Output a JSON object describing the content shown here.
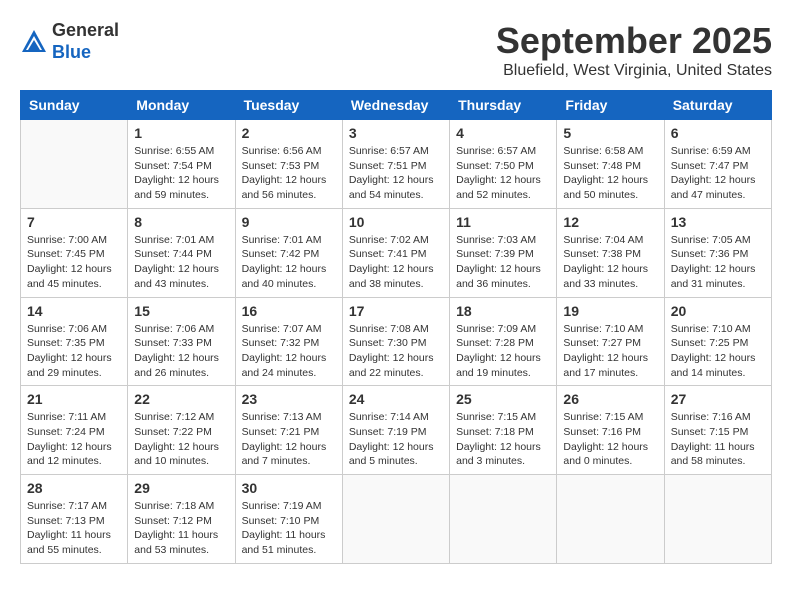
{
  "header": {
    "logo_general": "General",
    "logo_blue": "Blue",
    "month_title": "September 2025",
    "location": "Bluefield, West Virginia, United States"
  },
  "weekdays": [
    "Sunday",
    "Monday",
    "Tuesday",
    "Wednesday",
    "Thursday",
    "Friday",
    "Saturday"
  ],
  "weeks": [
    [
      {
        "day": "",
        "info": ""
      },
      {
        "day": "1",
        "info": "Sunrise: 6:55 AM\nSunset: 7:54 PM\nDaylight: 12 hours\nand 59 minutes."
      },
      {
        "day": "2",
        "info": "Sunrise: 6:56 AM\nSunset: 7:53 PM\nDaylight: 12 hours\nand 56 minutes."
      },
      {
        "day": "3",
        "info": "Sunrise: 6:57 AM\nSunset: 7:51 PM\nDaylight: 12 hours\nand 54 minutes."
      },
      {
        "day": "4",
        "info": "Sunrise: 6:57 AM\nSunset: 7:50 PM\nDaylight: 12 hours\nand 52 minutes."
      },
      {
        "day": "5",
        "info": "Sunrise: 6:58 AM\nSunset: 7:48 PM\nDaylight: 12 hours\nand 50 minutes."
      },
      {
        "day": "6",
        "info": "Sunrise: 6:59 AM\nSunset: 7:47 PM\nDaylight: 12 hours\nand 47 minutes."
      }
    ],
    [
      {
        "day": "7",
        "info": "Sunrise: 7:00 AM\nSunset: 7:45 PM\nDaylight: 12 hours\nand 45 minutes."
      },
      {
        "day": "8",
        "info": "Sunrise: 7:01 AM\nSunset: 7:44 PM\nDaylight: 12 hours\nand 43 minutes."
      },
      {
        "day": "9",
        "info": "Sunrise: 7:01 AM\nSunset: 7:42 PM\nDaylight: 12 hours\nand 40 minutes."
      },
      {
        "day": "10",
        "info": "Sunrise: 7:02 AM\nSunset: 7:41 PM\nDaylight: 12 hours\nand 38 minutes."
      },
      {
        "day": "11",
        "info": "Sunrise: 7:03 AM\nSunset: 7:39 PM\nDaylight: 12 hours\nand 36 minutes."
      },
      {
        "day": "12",
        "info": "Sunrise: 7:04 AM\nSunset: 7:38 PM\nDaylight: 12 hours\nand 33 minutes."
      },
      {
        "day": "13",
        "info": "Sunrise: 7:05 AM\nSunset: 7:36 PM\nDaylight: 12 hours\nand 31 minutes."
      }
    ],
    [
      {
        "day": "14",
        "info": "Sunrise: 7:06 AM\nSunset: 7:35 PM\nDaylight: 12 hours\nand 29 minutes."
      },
      {
        "day": "15",
        "info": "Sunrise: 7:06 AM\nSunset: 7:33 PM\nDaylight: 12 hours\nand 26 minutes."
      },
      {
        "day": "16",
        "info": "Sunrise: 7:07 AM\nSunset: 7:32 PM\nDaylight: 12 hours\nand 24 minutes."
      },
      {
        "day": "17",
        "info": "Sunrise: 7:08 AM\nSunset: 7:30 PM\nDaylight: 12 hours\nand 22 minutes."
      },
      {
        "day": "18",
        "info": "Sunrise: 7:09 AM\nSunset: 7:28 PM\nDaylight: 12 hours\nand 19 minutes."
      },
      {
        "day": "19",
        "info": "Sunrise: 7:10 AM\nSunset: 7:27 PM\nDaylight: 12 hours\nand 17 minutes."
      },
      {
        "day": "20",
        "info": "Sunrise: 7:10 AM\nSunset: 7:25 PM\nDaylight: 12 hours\nand 14 minutes."
      }
    ],
    [
      {
        "day": "21",
        "info": "Sunrise: 7:11 AM\nSunset: 7:24 PM\nDaylight: 12 hours\nand 12 minutes."
      },
      {
        "day": "22",
        "info": "Sunrise: 7:12 AM\nSunset: 7:22 PM\nDaylight: 12 hours\nand 10 minutes."
      },
      {
        "day": "23",
        "info": "Sunrise: 7:13 AM\nSunset: 7:21 PM\nDaylight: 12 hours\nand 7 minutes."
      },
      {
        "day": "24",
        "info": "Sunrise: 7:14 AM\nSunset: 7:19 PM\nDaylight: 12 hours\nand 5 minutes."
      },
      {
        "day": "25",
        "info": "Sunrise: 7:15 AM\nSunset: 7:18 PM\nDaylight: 12 hours\nand 3 minutes."
      },
      {
        "day": "26",
        "info": "Sunrise: 7:15 AM\nSunset: 7:16 PM\nDaylight: 12 hours\nand 0 minutes."
      },
      {
        "day": "27",
        "info": "Sunrise: 7:16 AM\nSunset: 7:15 PM\nDaylight: 11 hours\nand 58 minutes."
      }
    ],
    [
      {
        "day": "28",
        "info": "Sunrise: 7:17 AM\nSunset: 7:13 PM\nDaylight: 11 hours\nand 55 minutes."
      },
      {
        "day": "29",
        "info": "Sunrise: 7:18 AM\nSunset: 7:12 PM\nDaylight: 11 hours\nand 53 minutes."
      },
      {
        "day": "30",
        "info": "Sunrise: 7:19 AM\nSunset: 7:10 PM\nDaylight: 11 hours\nand 51 minutes."
      },
      {
        "day": "",
        "info": ""
      },
      {
        "day": "",
        "info": ""
      },
      {
        "day": "",
        "info": ""
      },
      {
        "day": "",
        "info": ""
      }
    ]
  ]
}
